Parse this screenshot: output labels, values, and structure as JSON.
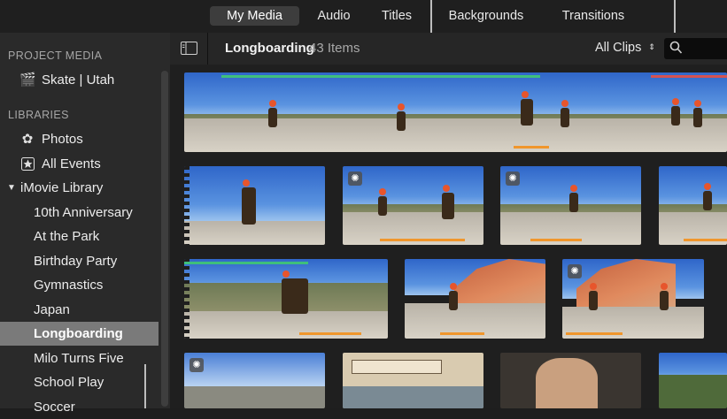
{
  "tabs": [
    {
      "label": "My Media",
      "active": true
    },
    {
      "label": "Audio",
      "active": false
    },
    {
      "label": "Titles",
      "active": false
    },
    {
      "label": "Backgrounds",
      "active": false
    },
    {
      "label": "Transitions",
      "active": false
    }
  ],
  "sidebar": {
    "project_media_header": "PROJECT MEDIA",
    "project": {
      "label": "Skate | Utah",
      "icon": "clapperboard-icon"
    },
    "libraries_header": "LIBRARIES",
    "photos": {
      "label": "Photos",
      "icon": "photos-flower-icon"
    },
    "all_events": {
      "label": "All Events",
      "icon": "star-icon"
    },
    "library": {
      "label": "iMovie Library",
      "icon": "disclosure-triangle-icon"
    },
    "events": [
      {
        "label": "10th Anniversary",
        "selected": false
      },
      {
        "label": "At the Park",
        "selected": false
      },
      {
        "label": "Birthday Party",
        "selected": false
      },
      {
        "label": "Gymnastics",
        "selected": false
      },
      {
        "label": "Japan",
        "selected": false
      },
      {
        "label": "Longboarding",
        "selected": true
      },
      {
        "label": "Milo Turns Five",
        "selected": false
      },
      {
        "label": "School Play",
        "selected": false
      },
      {
        "label": "Soccer",
        "selected": false
      }
    ]
  },
  "header": {
    "event_title": "Longboarding",
    "item_count": "43 Items",
    "filter": "All Clips"
  },
  "colors": {
    "accent_orange": "#f0962c",
    "accent_green": "#3fbf7b",
    "accent_red": "#d55252",
    "selection_gray": "#7a7a7a"
  }
}
